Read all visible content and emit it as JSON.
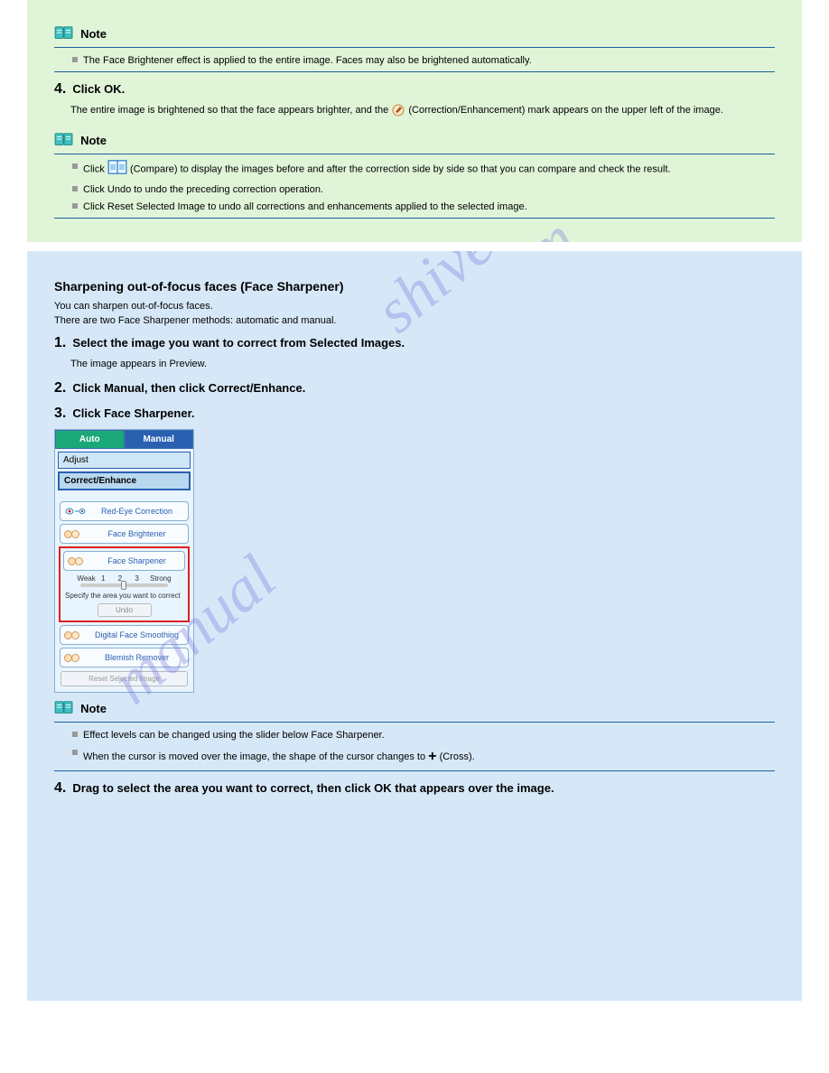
{
  "green": {
    "note1_label": "Note",
    "note1_bullet": "The Face Brightener effect is applied to the entire image. Faces may also be brightened automatically.",
    "step4_num": "4.",
    "step4_title": "Click OK.",
    "step4_body_a": "The entire image is brightened so that the face appears brighter, and the ",
    "step4_body_b": " (Correction/Enhancement) mark appears on the upper left of the image.",
    "note2_label": "Note",
    "note2_bullets": [
      {
        "pre": "Click ",
        "post": " (Compare) to display the images before and after the correction side by side so that you can compare and check the result."
      },
      {
        "text": "Click Undo to undo the preceding correction operation."
      },
      {
        "text": "Click Reset Selected Image to undo all corrections and enhancements applied to the selected image."
      }
    ]
  },
  "blue": {
    "title": "Sharpening out-of-focus faces (Face Sharpener)",
    "intro": "You can sharpen out-of-focus faces.",
    "intro2": "There are two Face Sharpener methods: automatic and manual.",
    "step1_num": "1.",
    "step1_title": "Select the image you want to correct from Selected Images.",
    "step1_body": "The image appears in Preview.",
    "step2_num": "2.",
    "step2_title": "Click Manual, then click Correct/Enhance.",
    "step3_num": "3.",
    "step3_title": "Click Face Sharpener.",
    "panel": {
      "tab_auto": "Auto",
      "tab_manual": "Manual",
      "adjust": "Adjust",
      "correct_enhance": "Correct/Enhance",
      "redeye": "Red-Eye Correction",
      "brightener": "Face Brightener",
      "sharpener": "Face Sharpener",
      "weak": "Weak",
      "strong": "Strong",
      "nums": "1 2 3",
      "specify": "Specify the area you want to correct",
      "undo": "Undo",
      "smoothing": "Digital Face Smoothing",
      "blemish": "Blemish Remover",
      "reset": "Reset Selected Image"
    },
    "note_label": "Note",
    "note_bullets": [
      {
        "text": "Effect levels can be changed using the slider below Face Sharpener."
      },
      {
        "pre": "When the cursor is moved over the image, the shape of the cursor changes to ",
        "post": " (Cross)."
      }
    ],
    "step4_num": "4.",
    "step4_title": "Drag to select the area you want to correct, then click OK that appears over the image."
  }
}
